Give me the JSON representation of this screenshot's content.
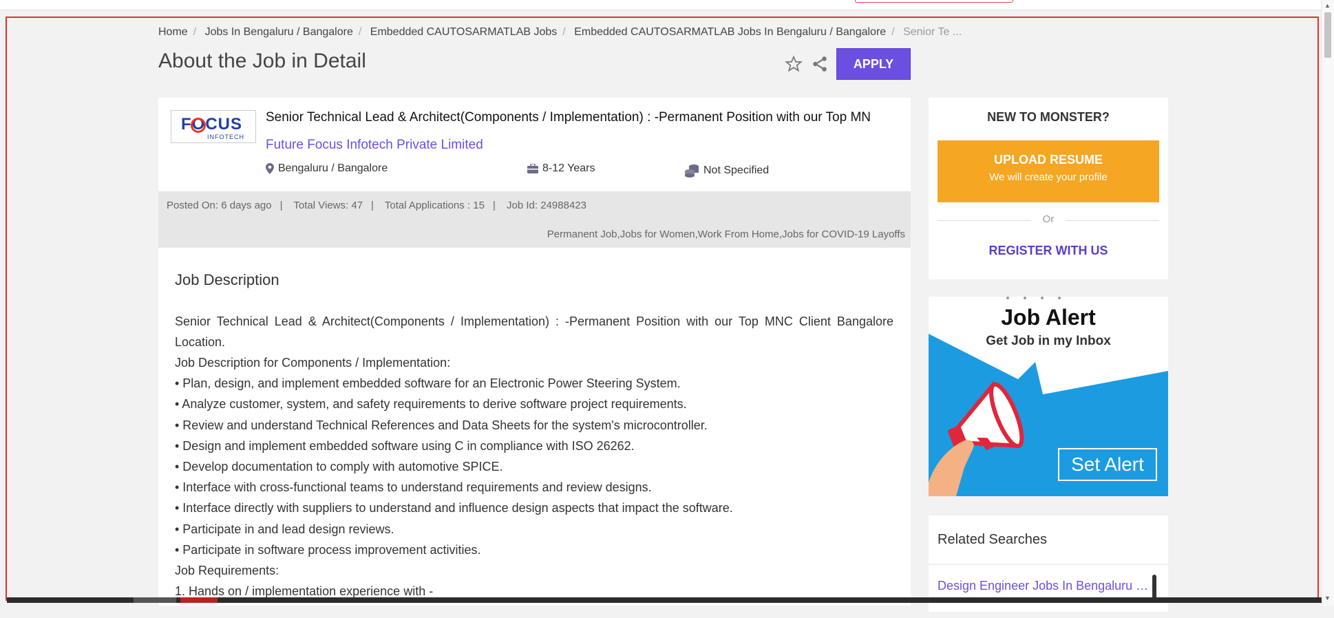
{
  "breadcrumb": {
    "items": [
      "Home",
      "Jobs In Bengaluru / Bangalore",
      "Embedded CAUTOSARMATLAB Jobs",
      "Embedded CAUTOSARMATLAB Jobs In Bengaluru / Bangalore"
    ],
    "current": "Senior Te ..."
  },
  "page_title": "About the Job in Detail",
  "apply_label": "APPLY",
  "job": {
    "logo_text": "FOCUS",
    "logo_sub": "INFOTECH",
    "title": "Senior Technical Lead & Architect(Components / Implementation) : -Permanent Position with our Top MN",
    "company": "Future Focus Infotech Private Limited",
    "location": "Bengaluru / Bangalore",
    "experience": "8-12 Years",
    "salary": "Not Specified"
  },
  "info": {
    "posted": "Posted On: 6 days ago",
    "views": "Total Views: 47",
    "applications": "Total Applications : 15",
    "job_id": "Job Id: 24988423",
    "tags": "Permanent Job,Jobs for Women,Work From Home,Jobs for COVID-19 Layoffs"
  },
  "description": {
    "heading": "Job Description",
    "lead": "Senior Technical Lead & Architect(Components / Implementation) : -Permanent Position with our Top MNC Client Bangalore Location.",
    "lines": [
      "Job Description for Components / Implementation:",
      "• Plan, design, and implement embedded software for an Electronic Power Steering System.",
      "• Analyze customer, system, and safety requirements to derive software project requirements.",
      "• Review and understand Technical References and Data Sheets for the system's microcontroller.",
      "• Design and implement embedded software using C in compliance with ISO 26262.",
      "• Develop documentation to comply with automotive SPICE.",
      "• Interface with cross-functional teams to understand requirements and review designs.",
      "• Interface directly with suppliers to understand and influence design aspects that impact the software.",
      "• Participate in and lead design reviews.",
      "• Participate in software process improvement activities.",
      "Job Requirements:",
      "1. Hands on / implementation experience with -"
    ]
  },
  "sidebar": {
    "new_to": "NEW TO MONSTER?",
    "upload": "UPLOAD RESUME",
    "upload_sub": "We will create your profile",
    "or": "Or",
    "register": "REGISTER WITH US"
  },
  "alert_banner": {
    "title": "Job Alert",
    "subtitle": "Get Job in my Inbox",
    "button": "Set Alert"
  },
  "related": {
    "heading": "Related Searches",
    "links": [
      "Design Engineer Jobs In Bengaluru / Bangalore"
    ]
  },
  "colors": {
    "accent": "#6c4fe0",
    "upload": "#f5a623",
    "alert_blue": "#1c9be0",
    "frame": "#e03131"
  }
}
